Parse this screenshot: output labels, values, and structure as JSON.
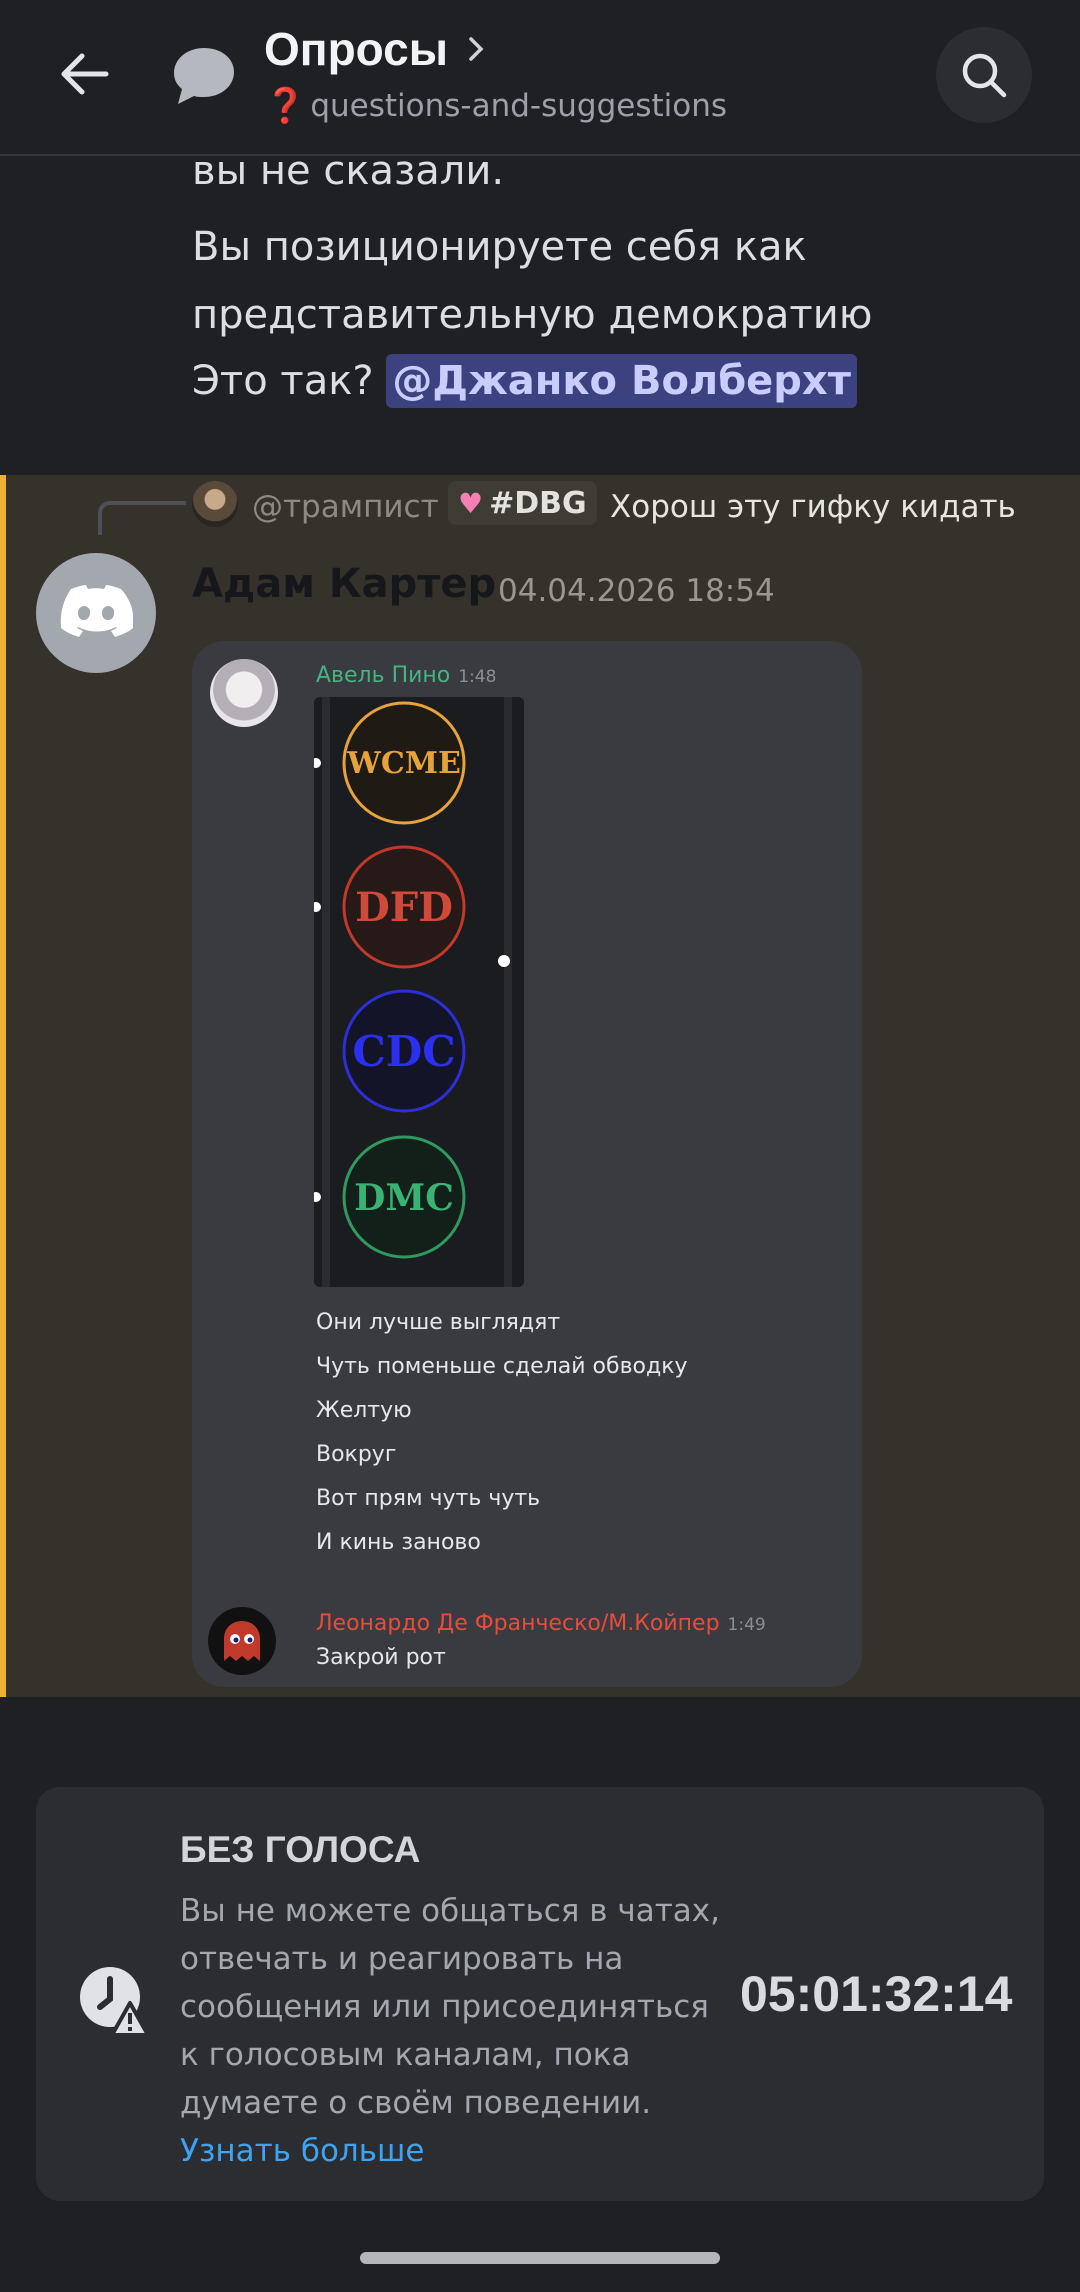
{
  "header": {
    "title": "Опросы",
    "channel": "questions-and-suggestions",
    "channel_emoji": "❓"
  },
  "prev_message": {
    "line1": "вы не сказали.",
    "line2": "Вы позиционируете себя как",
    "line3": "представительную демократию",
    "line4_text": "Это так? ",
    "mention": "@Джанко Волберхт"
  },
  "message": {
    "reply_name": "@трампист",
    "reply_tag": "#DBG",
    "reply_text": "Хорош эту гифку кидать",
    "author": "Адам Картер",
    "timestamp": "04.04.2026 18:54",
    "embed": {
      "user1": "Авель Пино",
      "time1": "1:48",
      "logos": [
        "WCME",
        "DFD",
        "CDC",
        "DMC"
      ],
      "lines": [
        "Они лучше выглядят",
        "Чуть поменьше сделай обводку",
        "Желтую",
        "Вокруг",
        "Вот прям чуть чуть",
        "И кинь заново"
      ],
      "user2": "Леонардо Де Франческо/М.Койпер",
      "time2": "1:49",
      "reply2": "Закрой рот"
    }
  },
  "timeout": {
    "title": "БЕЗ ГОЛОСА",
    "description": "Вы не можете общаться в чатах, отвечать и реагировать на сообщения или присоединяться к голосовым каналам, пока думаете о своём поведении.",
    "learn_more": "Узнать больше",
    "countdown": "05:01:32:14"
  },
  "colors": {
    "highlight_border": "#f0b132",
    "mention_bg": "#3c4280",
    "link": "#3ea4f1"
  }
}
